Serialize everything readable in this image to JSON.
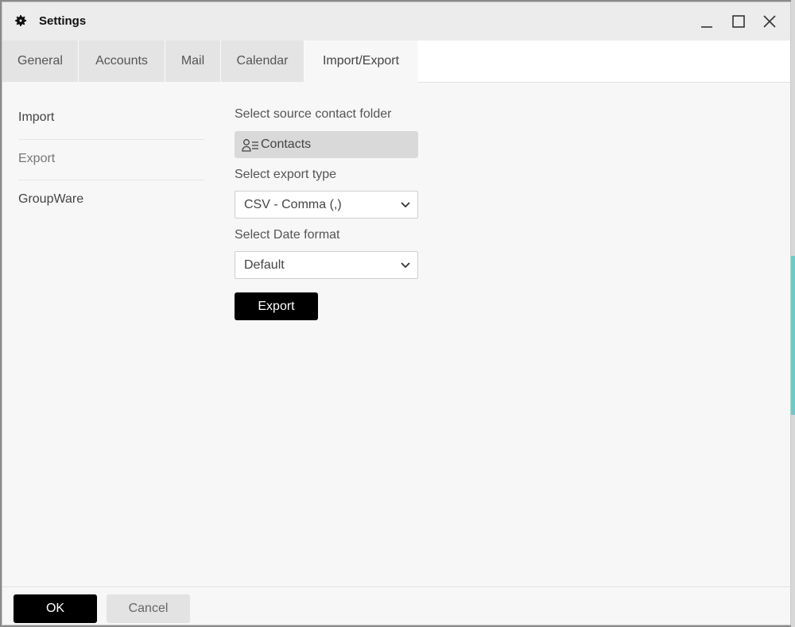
{
  "window": {
    "title": "Settings",
    "icon": "gear-icon"
  },
  "tabs": [
    {
      "label": "General",
      "active": false
    },
    {
      "label": "Accounts",
      "active": false
    },
    {
      "label": "Mail",
      "active": false
    },
    {
      "label": "Calendar",
      "active": false
    },
    {
      "label": "Import/Export",
      "active": true
    }
  ],
  "sidebar": {
    "items": [
      {
        "label": "Import"
      },
      {
        "label": "Export",
        "selected": true
      },
      {
        "label": "GroupWare"
      }
    ]
  },
  "export_form": {
    "source_label": "Select source contact folder",
    "source_folder": "Contacts",
    "source_icon": "contacts-icon",
    "type_label": "Select export type",
    "type_value": "CSV - Comma (,)",
    "date_label": "Select Date format",
    "date_value": "Default",
    "export_button": "Export"
  },
  "footer": {
    "ok": "OK",
    "cancel": "Cancel"
  },
  "colors": {
    "accent": "#000000",
    "active_tab": "#f7f7f7",
    "inactive_tab": "#e4e4e4"
  }
}
